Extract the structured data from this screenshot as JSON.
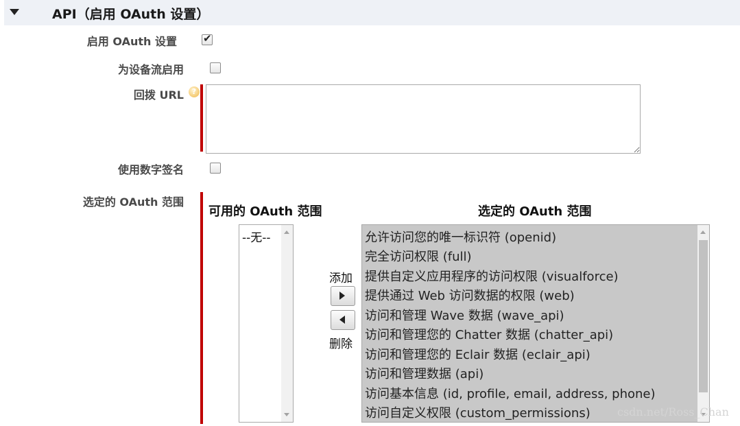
{
  "section": {
    "title": "API（启用 OAuth 设置）",
    "collapse_icon": "triangle-down-icon"
  },
  "fields": {
    "enable_oauth": {
      "label": "启用 OAuth 设置",
      "checked": true
    },
    "device_flow": {
      "label": "为设备流启用",
      "checked": false
    },
    "callback_url": {
      "label": "回拨 URL",
      "value": "",
      "help_icon": "help-icon"
    },
    "digital_signature": {
      "label": "使用数字签名",
      "checked": false
    },
    "oauth_scopes": {
      "label": "选定的 OAuth 范围"
    }
  },
  "scopes": {
    "available_title": "可用的 OAuth 范围",
    "selected_title": "选定的 OAuth 范围",
    "available_items": [
      "--无--"
    ],
    "selected_items": [
      "允许访问您的唯一标识符 (openid)",
      "完全访问权限 (full)",
      "提供自定义应用程序的访问权限 (visualforce)",
      "提供通过 Web 访问数据的权限 (web)",
      "访问和管理 Wave 数据 (wave_api)",
      "访问和管理您的 Chatter 数据 (chatter_api)",
      "访问和管理您的 Eclair 数据 (eclair_api)",
      "访问和管理数据 (api)",
      "访问基本信息 (id, profile, email, address, phone)",
      "访问自定义权限 (custom_permissions)"
    ],
    "add_label": "添加",
    "remove_label": "删除"
  },
  "watermark": "csdn.net/Ross_Chan",
  "colors": {
    "required_bar": "#c00000",
    "header_bg": "#eef1f6",
    "selected_list_bg": "#c8c8c8"
  }
}
